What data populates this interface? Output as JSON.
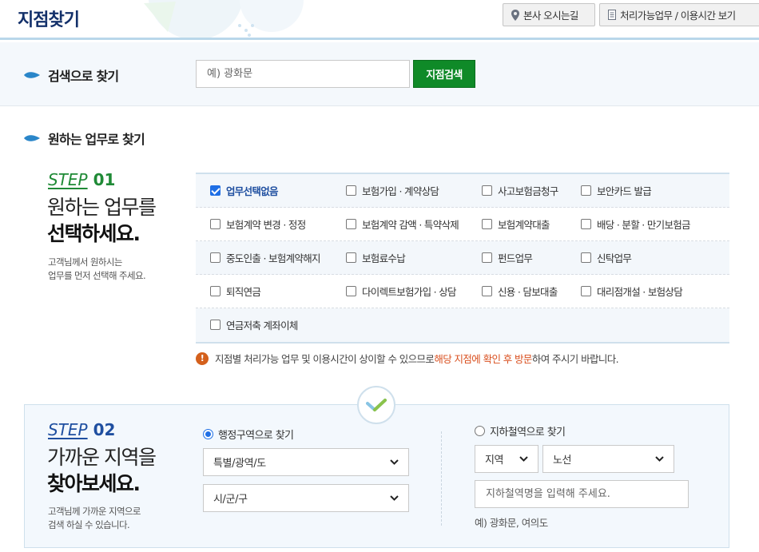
{
  "header": {
    "title": "지점찾기",
    "office_button": "본사 오시는길",
    "hours_button": "처리가능업무 / 이용시간 보기"
  },
  "search": {
    "title": "검색으로 찾기",
    "placeholder": "예) 광화문",
    "button": "지점검색"
  },
  "work": {
    "title": "원하는 업무로 찾기"
  },
  "step1": {
    "step_word": "STEP",
    "step_num": "01",
    "line1": "원하는 업무를",
    "line2": "선택하세요.",
    "desc1": "고객님께서 원하시는",
    "desc2": "업무를 먼저 선택해 주세요."
  },
  "tasks": {
    "items": [
      {
        "label": "업무선택없음",
        "checked": true
      },
      {
        "label": "보험가입 · 계약상담",
        "checked": false
      },
      {
        "label": "사고보험금청구",
        "checked": false
      },
      {
        "label": "보안카드 발급",
        "checked": false
      },
      {
        "label": "보험계약 변경 · 정정",
        "checked": false
      },
      {
        "label": "보험계약 감액 · 특약삭제",
        "checked": false
      },
      {
        "label": "보험계약대출",
        "checked": false
      },
      {
        "label": "배당 · 분할 · 만기보험금",
        "checked": false
      },
      {
        "label": "중도인출 · 보험계약해지",
        "checked": false
      },
      {
        "label": "보험료수납",
        "checked": false
      },
      {
        "label": "펀드업무",
        "checked": false
      },
      {
        "label": "신탁업무",
        "checked": false
      },
      {
        "label": "퇴직연금",
        "checked": false
      },
      {
        "label": "다이렉트보험가입 · 상담",
        "checked": false
      },
      {
        "label": "신용 · 담보대출",
        "checked": false
      },
      {
        "label": "대리점개설 · 보험상담",
        "checked": false
      },
      {
        "label": "연금저축 계좌이체",
        "checked": false
      }
    ]
  },
  "notice": {
    "pre": "지점별 처리가능 업무 및 이용시간이 상이할 수 있으므로 ",
    "highlight": "해당 지점에 확인 후 방문",
    "post": "하여 주시기 바랍니다."
  },
  "step2": {
    "step_word": "STEP",
    "step_num": "02",
    "line1": "가까운 지역을",
    "line2": "찾아보세요.",
    "desc1": "고객님께 가까운 지역으로",
    "desc2": "검색 하실 수 있습니다.",
    "admin_radio": "행정구역으로 찾기",
    "subway_radio": "지하철역으로 찾기",
    "city_select": "특별/광역/도",
    "district_select": "시/군/구",
    "region_select": "지역",
    "line_select": "노선",
    "subway_placeholder": "지하철역명을 입력해 주세요.",
    "example": "예) 광화문, 여의도"
  },
  "colors": {
    "brand_green": "#0f8a28",
    "navy": "#13306a",
    "accent_blue": "#1f4fa0",
    "warning": "#d94f1e"
  }
}
